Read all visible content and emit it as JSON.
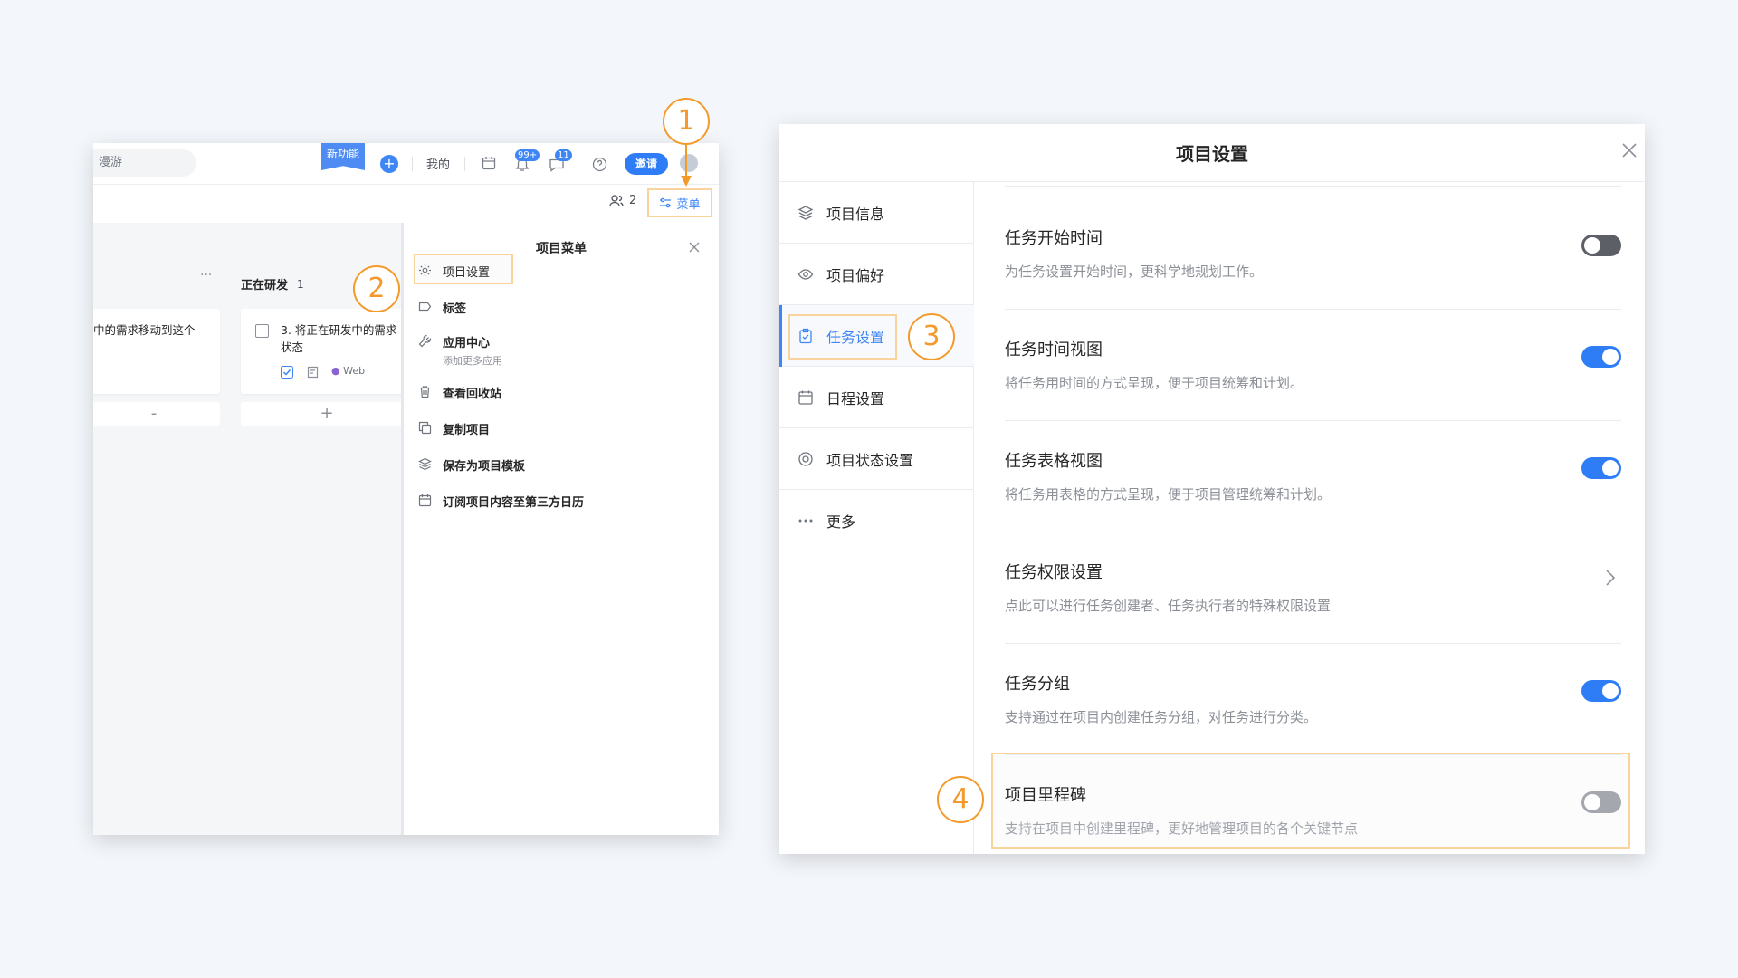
{
  "left_window": {
    "topbar": {
      "search_text": "漫游",
      "new_feature": "新功能",
      "mine": "我的",
      "notif_badge": "99+",
      "msg_badge": "11",
      "invite": "邀请"
    },
    "subbar": {
      "member_count": "2",
      "menu_label": "菜单"
    },
    "board": {
      "card1_text": "中的需求移动到这个",
      "column_title": "正在研发",
      "column_count": "1",
      "card2_text_line1": "3. 将正在研发中的需求",
      "card2_text_line2": "状态",
      "card2_tag": "Web"
    },
    "menu_panel": {
      "title": "项目菜单",
      "items": [
        {
          "label": "项目设置",
          "icon": "gear-icon"
        },
        {
          "label": "标签",
          "icon": "tag-icon"
        },
        {
          "label": "应用中心",
          "sub": "添加更多应用",
          "icon": "wrench-icon"
        },
        {
          "label": "查看回收站",
          "icon": "trash-icon"
        },
        {
          "label": "复制项目",
          "icon": "copy-icon"
        },
        {
          "label": "保存为项目模板",
          "icon": "layers-icon"
        },
        {
          "label": "订阅项目内容至第三方日历",
          "icon": "calendar-icon"
        }
      ]
    }
  },
  "right_window": {
    "title": "项目设置",
    "nav": [
      {
        "label": "项目信息",
        "icon": "layers-icon"
      },
      {
        "label": "项目偏好",
        "icon": "eye-icon"
      },
      {
        "label": "任务设置",
        "icon": "clipboard-icon",
        "active": true
      },
      {
        "label": "日程设置",
        "icon": "calendar-icon"
      },
      {
        "label": "项目状态设置",
        "icon": "status-icon"
      },
      {
        "label": "更多",
        "icon": "ellipsis-icon"
      }
    ],
    "settings": [
      {
        "title": "任务开始时间",
        "desc": "为任务设置开始时间，更科学地规划工作。",
        "control": "toggle",
        "on": false
      },
      {
        "title": "任务时间视图",
        "desc": "将任务用时间的方式呈现，便于项目统筹和计划。",
        "control": "toggle",
        "on": true
      },
      {
        "title": "任务表格视图",
        "desc": "将任务用表格的方式呈现，便于项目管理统筹和计划。",
        "control": "toggle",
        "on": true
      },
      {
        "title": "任务权限设置",
        "desc": "点此可以进行任务创建者、任务执行者的特殊权限设置",
        "control": "chevron"
      },
      {
        "title": "任务分组",
        "desc": "支持通过在项目内创建任务分组，对任务进行分类。",
        "control": "toggle",
        "on": true
      },
      {
        "title": "项目里程碑",
        "desc": "支持在项目中创建里程碑，更好地管理项目的各个关键节点",
        "control": "toggle",
        "on": false
      }
    ]
  },
  "callouts": [
    "1",
    "2",
    "3",
    "4"
  ],
  "colors": {
    "accent": "#3e86f5",
    "callout": "#f39a2b",
    "highlight": "#f8d39b"
  }
}
